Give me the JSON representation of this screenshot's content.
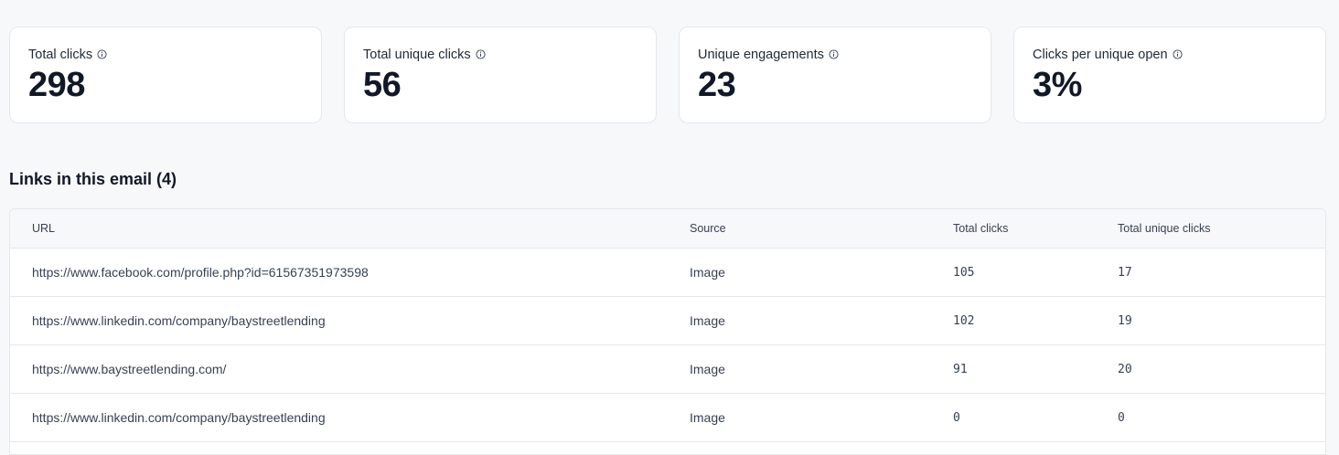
{
  "stats": [
    {
      "label": "Total clicks",
      "value": "298",
      "icon": "info-icon"
    },
    {
      "label": "Total unique clicks",
      "value": "56",
      "icon": "info-icon"
    },
    {
      "label": "Unique engagements",
      "value": "23",
      "icon": "info-icon"
    },
    {
      "label": "Clicks per unique open",
      "value": "3%",
      "icon": "info-icon"
    }
  ],
  "links": {
    "title": "Links in this email (4)",
    "columns": {
      "url": "URL",
      "source": "Source",
      "total_clicks": "Total clicks",
      "total_unique_clicks": "Total unique clicks"
    },
    "rows": [
      {
        "url": "https://www.facebook.com/profile.php?id=61567351973598",
        "source": "Image",
        "total_clicks": "105",
        "total_unique_clicks": "17"
      },
      {
        "url": "https://www.linkedin.com/company/baystreetlending",
        "source": "Image",
        "total_clicks": "102",
        "total_unique_clicks": "19"
      },
      {
        "url": "https://www.baystreetlending.com/",
        "source": "Image",
        "total_clicks": "91",
        "total_unique_clicks": "20"
      },
      {
        "url": "https://www.linkedin.com/company/baystreetlending",
        "source": "Image",
        "total_clicks": "0",
        "total_unique_clicks": "0"
      }
    ]
  }
}
